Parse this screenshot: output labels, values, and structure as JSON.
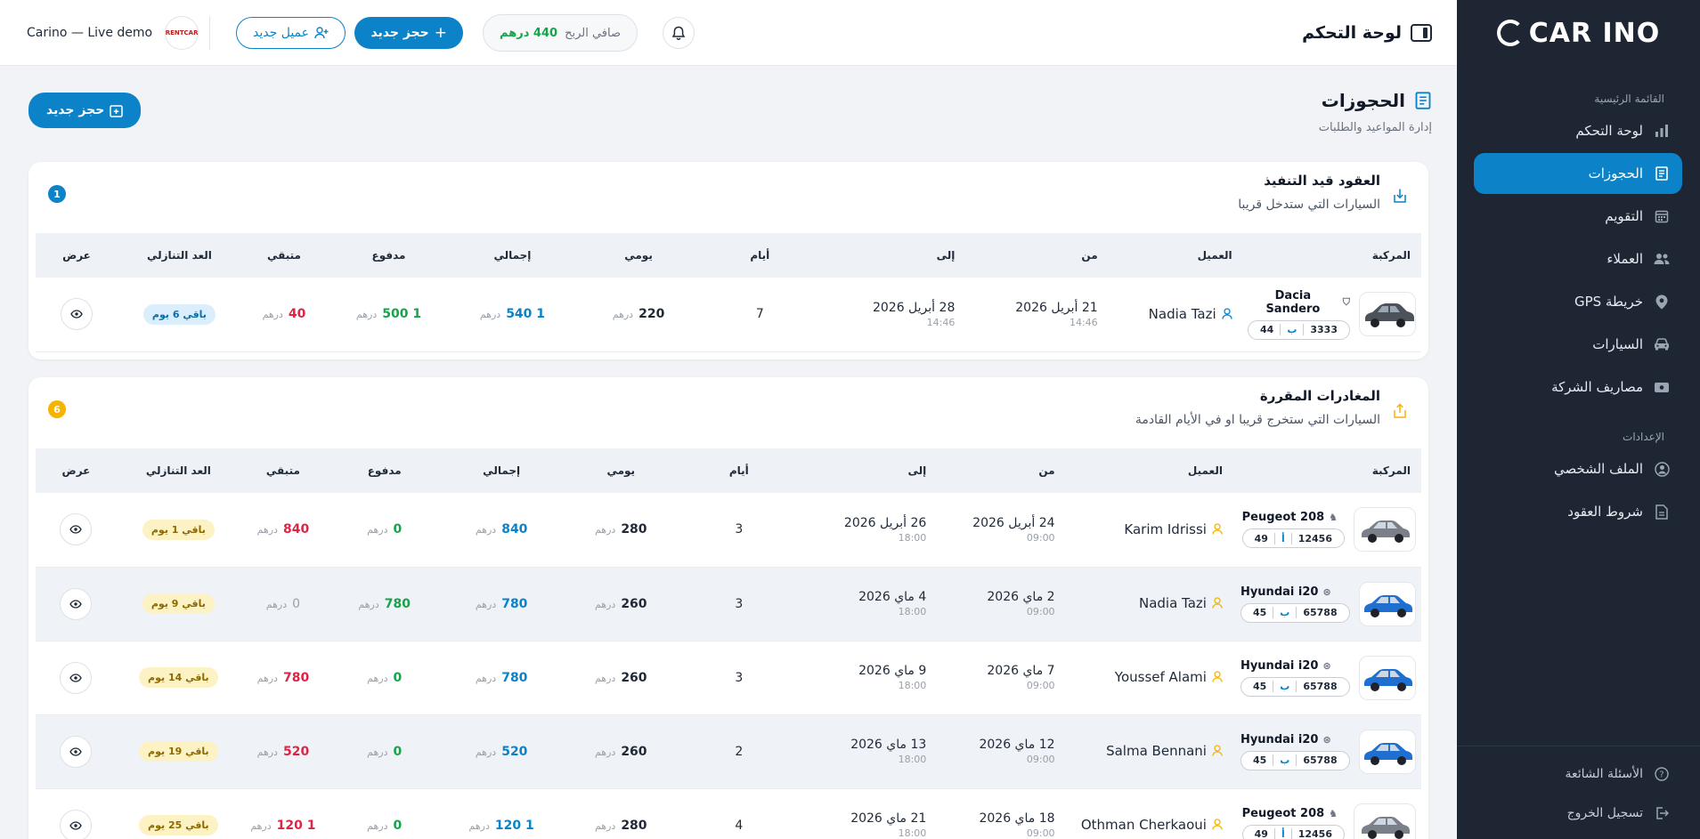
{
  "sidebar": {
    "logo": "CAR INO",
    "sections": {
      "main": "القائمة الرئيسية",
      "settings": "الإعدادات"
    },
    "items": [
      {
        "label": "لوحة التحكم",
        "icon": "bar-chart-icon"
      },
      {
        "label": "الحجوزات",
        "icon": "receipt-icon",
        "active": true
      },
      {
        "label": "التقويم",
        "icon": "calendar-icon"
      },
      {
        "label": "العملاء",
        "icon": "users-icon"
      },
      {
        "label": "خريطة GPS",
        "icon": "map-pin-icon"
      },
      {
        "label": "السيارات",
        "icon": "car-icon"
      },
      {
        "label": "مصاريف الشركة",
        "icon": "wallet-icon"
      }
    ],
    "settings_items": [
      {
        "label": "الملف الشخصي",
        "icon": "user-circle-icon"
      },
      {
        "label": "شروط العقود",
        "icon": "document-icon"
      }
    ],
    "bottom_items": [
      {
        "label": "الأسئلة الشائعة",
        "icon": "help-icon"
      },
      {
        "label": "تسجيل الخروج",
        "icon": "logout-icon"
      }
    ]
  },
  "topbar": {
    "title": "لوحة التحكم",
    "profit_label": "صافي الربح",
    "profit_value": "440 درهم",
    "new_booking": "حجز جديد",
    "new_client": "عميل جديد",
    "company_name": "Carino — Live demo",
    "company_logo": "RENTCAR"
  },
  "page": {
    "title": "الحجوزات",
    "subtitle": "إدارة المواعيد والطلبات",
    "new_booking": "حجز جديد"
  },
  "currency": "درهم",
  "columns": {
    "vehicle": "المركبة",
    "client": "العميل",
    "from": "من",
    "to": "إلى",
    "days": "أيام",
    "daily": "يومي",
    "total": "إجمالي",
    "paid": "مدفوع",
    "remaining": "متبقي",
    "countdown": "العد التنازلي",
    "view": "عرض"
  },
  "ongoing": {
    "title": "العقود قيد التنفيذ",
    "subtitle": "السيارات التي ستدخل قريبا",
    "count": "1",
    "badge_color": "#0c82c8",
    "rows": [
      {
        "car": "Dacia Sandero",
        "plate": [
          "44",
          "ب",
          "3333"
        ],
        "client": "Nadia Tazi",
        "from_date": "21 أبريل 2026",
        "from_time": "14:46",
        "to_date": "28 أبريل 2026",
        "to_time": "14:46",
        "days": "7",
        "daily": "220",
        "total": "1 540",
        "paid": "1 500",
        "remaining": "40",
        "countdown": "باقي 6 يوم"
      }
    ]
  },
  "departures": {
    "title": "المغادرات المقررة",
    "subtitle": "السيارات التي ستخرج قريبا او في الأيام القادمة",
    "count": "6",
    "badge_color": "#f5b400",
    "rows": [
      {
        "car": "Peugeot 208",
        "plate": [
          "49",
          "أ",
          "12456"
        ],
        "client": "Karim Idrissi",
        "from_date": "24 أبريل 2026",
        "from_time": "09:00",
        "to_date": "26 أبريل 2026",
        "to_time": "18:00",
        "days": "3",
        "daily": "280",
        "total": "840",
        "paid": "0",
        "remaining": "840",
        "countdown": "باقي 1 يوم"
      },
      {
        "car": "Hyundai i20",
        "plate": [
          "45",
          "ب",
          "65788"
        ],
        "client": "Nadia Tazi",
        "from_date": "2 ماي 2026",
        "from_time": "09:00",
        "to_date": "4 ماي 2026",
        "to_time": "18:00",
        "days": "3",
        "daily": "260",
        "total": "780",
        "paid": "780",
        "remaining": "0",
        "countdown": "باقي 9 يوم"
      },
      {
        "car": "Hyundai i20",
        "plate": [
          "45",
          "ب",
          "65788"
        ],
        "client": "Youssef Alami",
        "from_date": "7 ماي 2026",
        "from_time": "09:00",
        "to_date": "9 ماي 2026",
        "to_time": "18:00",
        "days": "3",
        "daily": "260",
        "total": "780",
        "paid": "0",
        "remaining": "780",
        "countdown": "باقي 14 يوم"
      },
      {
        "car": "Hyundai i20",
        "plate": [
          "45",
          "ب",
          "65788"
        ],
        "client": "Salma Bennani",
        "from_date": "12 ماي 2026",
        "from_time": "09:00",
        "to_date": "13 ماي 2026",
        "to_time": "18:00",
        "days": "2",
        "daily": "260",
        "total": "520",
        "paid": "0",
        "remaining": "520",
        "countdown": "باقي 19 يوم"
      },
      {
        "car": "Peugeot 208",
        "plate": [
          "49",
          "أ",
          "12456"
        ],
        "client": "Othman Cherkaoui",
        "from_date": "18 ماي 2026",
        "from_time": "09:00",
        "to_date": "21 ماي 2026",
        "to_time": "18:00",
        "days": "4",
        "daily": "280",
        "total": "1 120",
        "paid": "0",
        "remaining": "1 120",
        "countdown": "باقي 25 يوم"
      }
    ]
  }
}
